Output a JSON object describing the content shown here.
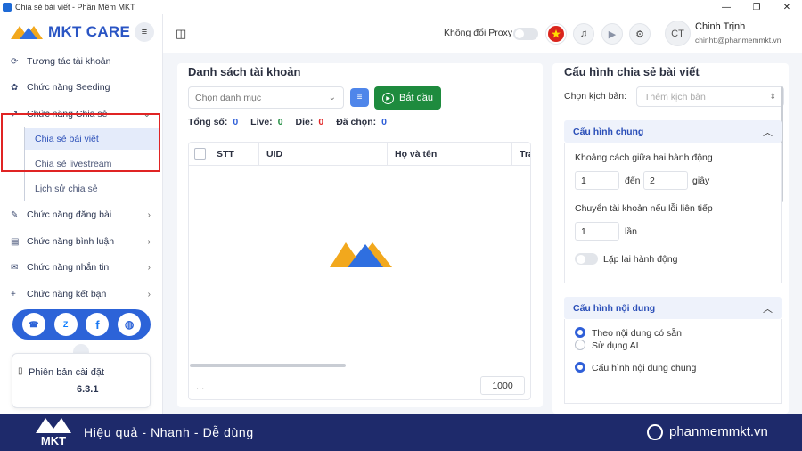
{
  "window": {
    "title": "Chia sẻ bài viết - Phần Mềm MKT"
  },
  "sidebar": {
    "logo_text": "MKT CARE",
    "items": [
      {
        "label": "Tương tác tài khoản"
      },
      {
        "label": "Chức năng Seeding"
      },
      {
        "label": "Chức năng Chia sẻ"
      },
      {
        "label": "Chức năng đăng bài"
      },
      {
        "label": "Chức năng bình luận"
      },
      {
        "label": "Chức năng nhắn tin"
      },
      {
        "label": "Chức năng kết bạn"
      }
    ],
    "subitems": [
      {
        "label": "Chia sẻ bài viết"
      },
      {
        "label": "Chia sẻ livestream"
      },
      {
        "label": "Lịch sử chia sẻ"
      }
    ],
    "version_label": "Phiên bản cài đặt",
    "version": "6.3.1"
  },
  "topbar": {
    "proxy_label": "Không đổi Proxy",
    "user_initials": "CT",
    "user_name": "Chinh Trịnh",
    "user_email": "chinhtt@phanmemmkt.vn"
  },
  "accounts": {
    "title": "Danh sách tài khoản",
    "category_placeholder": "Chọn danh mục",
    "start_label": "Bắt đầu",
    "stats": {
      "total_label": "Tổng số:",
      "total": "0",
      "live_label": "Live:",
      "live": "0",
      "die_label": "Die:",
      "die": "0",
      "selected_label": "Đã chọn:",
      "selected": "0"
    },
    "columns": [
      "STT",
      "UID",
      "Họ và tên",
      "Trạ"
    ],
    "footer_dots": "...",
    "page_size": "1000"
  },
  "config": {
    "title": "Cấu hình chia sẻ bài viết",
    "script_label": "Chọn kịch bản:",
    "script_placeholder": "Thêm kịch bản",
    "general": {
      "title": "Cấu hình chung",
      "interval_label": "Khoảng cách giữa hai hành động",
      "from": "1",
      "to_label": "đến",
      "to": "2",
      "unit": "giây",
      "switch_label": "Chuyển tài khoản nếu lỗi liên tiếp",
      "times": "1",
      "times_unit": "lần",
      "repeat_label": "Lặp lại hành động"
    },
    "content": {
      "title": "Cấu hình nội dung",
      "opt1": "Theo nội dung có sẵn",
      "opt2": "Sử dụng AI",
      "opt3": "Cấu hình nội dung chung"
    }
  },
  "footer": {
    "logo": "MKT",
    "slogan": "Hiệu quả - Nhanh - Dễ dùng",
    "site": "phanmemmkt.vn"
  },
  "colors": {
    "accent": "#2b4fb8",
    "start": "#1e8b3e",
    "highlight_box": "#e02424",
    "footer": "#1e2a6b"
  }
}
